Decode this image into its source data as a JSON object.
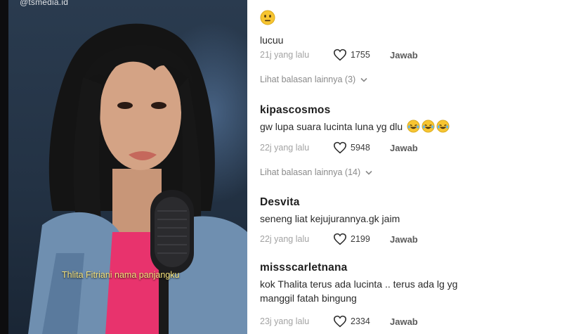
{
  "video": {
    "watermark": "@tsmedia.id",
    "caption": "Thlita Fitriani nama panjangku"
  },
  "comments": [
    {
      "username": "",
      "emoji_icon": "neutral-face-emoji-icon",
      "text": "lucuu",
      "time": "21j yang lalu",
      "likes": "1755",
      "reply_label": "Jawab",
      "more_replies": "Lihat balasan lainnya (3)"
    },
    {
      "username": "kipascosmos",
      "text": "gw lupa suara lucinta luna yg dlu",
      "text_emojis": [
        "laughing-tears-emoji-icon",
        "laughing-tears-emoji-icon",
        "laughing-tears-emoji-icon"
      ],
      "time": "22j yang lalu",
      "likes": "5948",
      "reply_label": "Jawab",
      "more_replies": "Lihat balasan lainnya (14)"
    },
    {
      "username": "Desvita",
      "text": "seneng liat kejujurannya.gk jaim",
      "time": "22j yang lalu",
      "likes": "2199",
      "reply_label": "Jawab"
    },
    {
      "username": "missscarletnana",
      "text": "kok Thalita terus ada lucinta .. terus ada lg yg manggil fatah bingung",
      "time": "23j yang lalu",
      "likes": "2334",
      "reply_label": "Jawab"
    }
  ],
  "colors": {
    "username": "#1e1e1e",
    "timestamp": "#a3a3a3",
    "caption": "#f6e27a",
    "emoji": "#f7c531"
  }
}
